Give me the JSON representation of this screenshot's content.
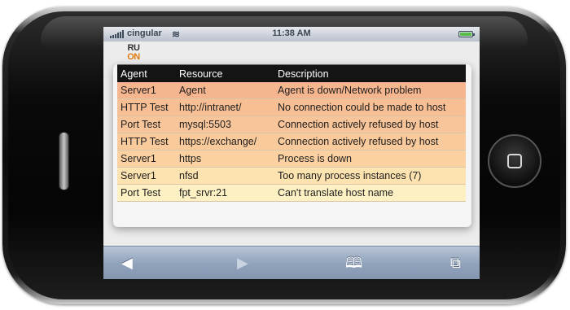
{
  "status_bar": {
    "carrier": "cingular",
    "time": "11:38 AM",
    "signal_icon": "signal-bars-icon",
    "wifi_icon": "wifi-icon",
    "battery_icon": "battery-icon",
    "battery_level": 1.0
  },
  "logo": {
    "line1": "RU",
    "line2": "ON"
  },
  "table": {
    "headers": {
      "agent": "Agent",
      "resource": "Resource",
      "description": "Description"
    },
    "rows": [
      {
        "agent": "Server1",
        "resource": "Agent",
        "description": "Agent is down/Network problem",
        "color": "#f5b58e"
      },
      {
        "agent": "HTTP Test",
        "resource": "http://intranet/",
        "description": "No connection could be made to host",
        "color": "#f7bf93"
      },
      {
        "agent": "Port Test",
        "resource": "mysql:5503",
        "description": "Connection actively refused by host",
        "color": "#f8c59a"
      },
      {
        "agent": "HTTP Test",
        "resource": "https://exchange/",
        "description": "Connection actively refused by host",
        "color": "#f9ca9c"
      },
      {
        "agent": "Server1",
        "resource": "https",
        "description": "Process is down",
        "color": "#fbd1a2"
      },
      {
        "agent": "Server1",
        "resource": "nfsd",
        "description": "Too many process instances (7)",
        "color": "#fde3b0"
      },
      {
        "agent": "Port Test",
        "resource": "fpt_srvr:21",
        "description": "Can't translate host name",
        "color": "#fdf1c4"
      }
    ]
  },
  "toolbar": {
    "back_icon": "back-arrow-icon",
    "forward_icon": "forward-arrow-icon",
    "bookmarks_icon": "bookmarks-icon",
    "pages_icon": "pages-icon",
    "back_glyph": "◀",
    "forward_glyph": "▶",
    "bookmarks_glyph": "🕮",
    "pages_glyph": "⧉"
  },
  "colors": {
    "header_bg": "#141414",
    "toolbar": "#92a4bc",
    "statusbar": "#c8ced7"
  }
}
